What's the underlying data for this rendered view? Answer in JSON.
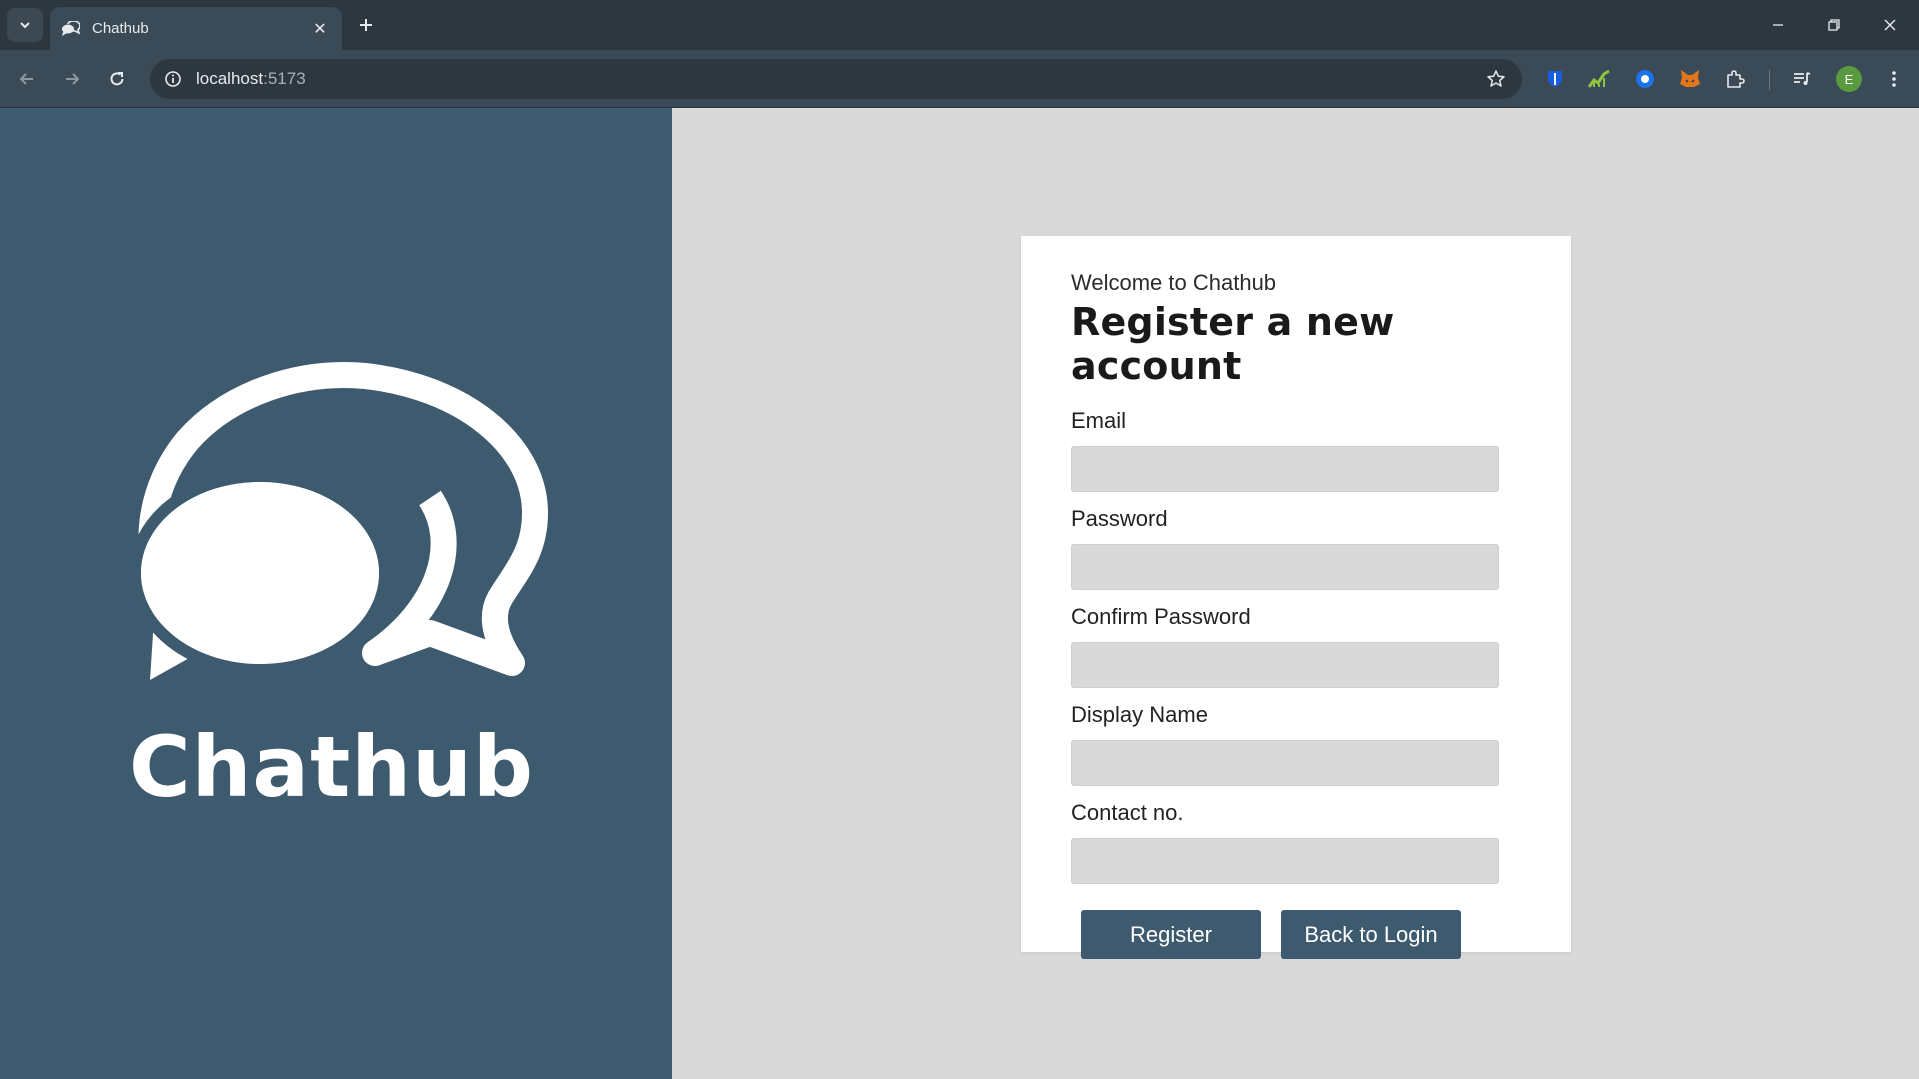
{
  "browser": {
    "tab_title": "Chathub",
    "url_host": "localhost",
    "url_port": ":5173",
    "profile_initial": "E"
  },
  "brand": {
    "name": "Chathub",
    "logo_icon": "chat-bubbles-icon",
    "panel_color": "#3e5a6f"
  },
  "form": {
    "welcome": "Welcome to Chathub",
    "heading": "Register a new account",
    "fields": [
      {
        "label": "Email",
        "value": "",
        "placeholder": ""
      },
      {
        "label": "Password",
        "value": "",
        "placeholder": ""
      },
      {
        "label": "Confirm Password",
        "value": "",
        "placeholder": ""
      },
      {
        "label": "Display Name",
        "value": "",
        "placeholder": ""
      },
      {
        "label": "Contact no.",
        "value": "",
        "placeholder": ""
      }
    ],
    "register_label": "Register",
    "back_label": "Back to Login",
    "accent_color": "#3e5a6f"
  }
}
